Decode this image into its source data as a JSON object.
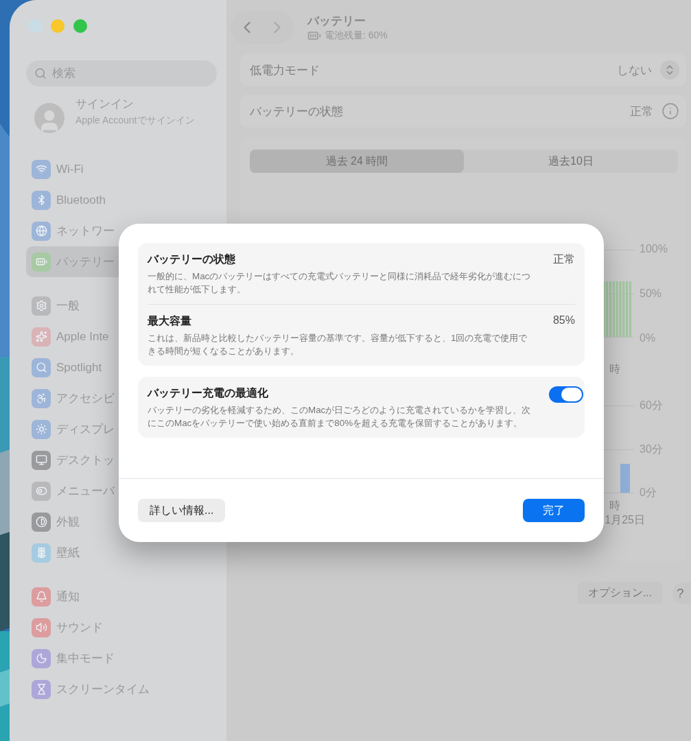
{
  "sidebar": {
    "search": {
      "placeholder": "検索"
    },
    "account": {
      "title": "サインイン",
      "subtitle": "Apple Accountでサインイン"
    },
    "groups": [
      {
        "items": [
          {
            "label": "Wi-Fi",
            "color": "#9db5d8",
            "selected": false
          },
          {
            "label": "Bluetooth",
            "color": "#9db5d8",
            "selected": false
          },
          {
            "label": "ネットワー",
            "color": "#9db5d8",
            "selected": false
          },
          {
            "label": "バッテリー",
            "color": "#a7c9a4",
            "selected": true
          }
        ]
      },
      {
        "items": [
          {
            "label": "一般",
            "color": "#b9b9bb",
            "selected": false
          },
          {
            "label": "Apple Inte",
            "color": "#d9b3b6",
            "selected": false
          },
          {
            "label": "Spotlight",
            "color": "#9db5d8",
            "selected": false
          },
          {
            "label": "アクセシビ",
            "color": "#9db5d8",
            "selected": false
          },
          {
            "label": "ディスプレ",
            "color": "#9db5d8",
            "selected": false
          },
          {
            "label": "デスクトッ",
            "color": "#9a9a9c",
            "selected": false
          },
          {
            "label": "メニューバ",
            "color": "#b9b9bb",
            "selected": false
          },
          {
            "label": "外観",
            "color": "#9a9a9c",
            "selected": false
          },
          {
            "label": "壁紙",
            "color": "#a5cbe0",
            "selected": false
          }
        ]
      },
      {
        "items": [
          {
            "label": "通知",
            "color": "#dd9c9e",
            "selected": false
          },
          {
            "label": "サウンド",
            "color": "#dd9c9e",
            "selected": false
          },
          {
            "label": "集中モード",
            "color": "#ada6d8",
            "selected": false
          },
          {
            "label": "スクリーンタイム",
            "color": "#ada6d8",
            "selected": false
          }
        ]
      }
    ]
  },
  "toolbar": {
    "title": "バッテリー",
    "subtitle": "電池残量: 60%"
  },
  "settings": [
    {
      "kind": "popup",
      "label": "低電力モード",
      "value": "しない"
    },
    {
      "kind": "info",
      "label": "バッテリーの状態",
      "value": "正常"
    }
  ],
  "range_tabs": [
    {
      "label": "過去 24 時間",
      "selected": true
    },
    {
      "label": "過去10日",
      "selected": false
    }
  ],
  "charts": [
    {
      "ticks": [
        "100%",
        "50%",
        "0%"
      ],
      "x_label": "時"
    },
    {
      "ticks": [
        "60分",
        "30分",
        "0分"
      ],
      "x_label": "時",
      "date": "1月25日"
    }
  ],
  "options_button": "オプション...",
  "help_button": "?",
  "dialog": {
    "sections": [
      {
        "items": [
          {
            "kind": "value",
            "title": "バッテリーの状態",
            "description": "一般的に、Macのバッテリーはすべての充電式バッテリーと同様に消耗品で経年劣化が進むにつれて性能が低下します。",
            "value": "正常"
          },
          {
            "kind": "value",
            "title": "最大容量",
            "description": "これは、新品時と比較したバッテリー容量の基準です。容量が低下すると、1回の充電で使用できる時間が短くなることがあります。",
            "value": "85%"
          }
        ]
      },
      {
        "items": [
          {
            "kind": "toggle",
            "title": "バッテリー充電の最適化",
            "description": "バッテリーの劣化を軽減するため、このMacが日ごろどのように充電されているかを学習し、次にこのMacをバッテリーで使い始める直前まで80%を超える充電を保留することがあります。",
            "on": true
          }
        ]
      }
    ],
    "buttons": [
      {
        "label": "詳しい情報...",
        "kind": "secondary"
      },
      {
        "label": "完了",
        "kind": "primary"
      }
    ]
  }
}
